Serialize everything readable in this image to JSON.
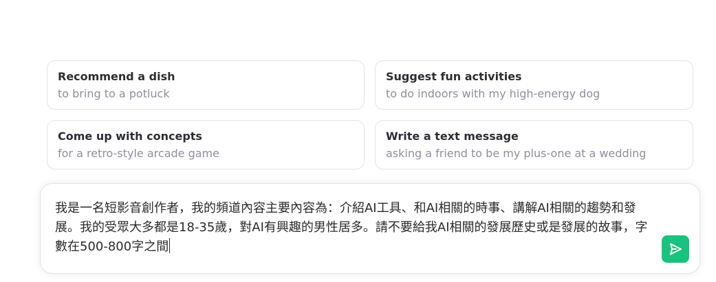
{
  "suggestions": [
    {
      "title": "Recommend a dish",
      "subtitle": "to bring to a potluck"
    },
    {
      "title": "Suggest fun activities",
      "subtitle": "to do indoors with my high-energy dog"
    },
    {
      "title": "Come up with concepts",
      "subtitle": "for a retro-style arcade game"
    },
    {
      "title": "Write a text message",
      "subtitle": "asking a friend to be my plus-one at a wedding"
    }
  ],
  "composer": {
    "value": "我是一名短影音創作者，我的頻道內容主要內容為：介紹AI工具、和AI相關的時事、講解AI相關的趨勢和發展。我的受眾大多都是18-35歲，對AI有興趣的男性居多。請不要給我AI相關的發展歷史或是發展的故事，字數在500-800字之間"
  },
  "colors": {
    "send_button": "#19c37d",
    "card_border": "#e3e3e7",
    "subtitle_text": "#8e8ea0"
  },
  "icons": {
    "send": "send-icon"
  }
}
